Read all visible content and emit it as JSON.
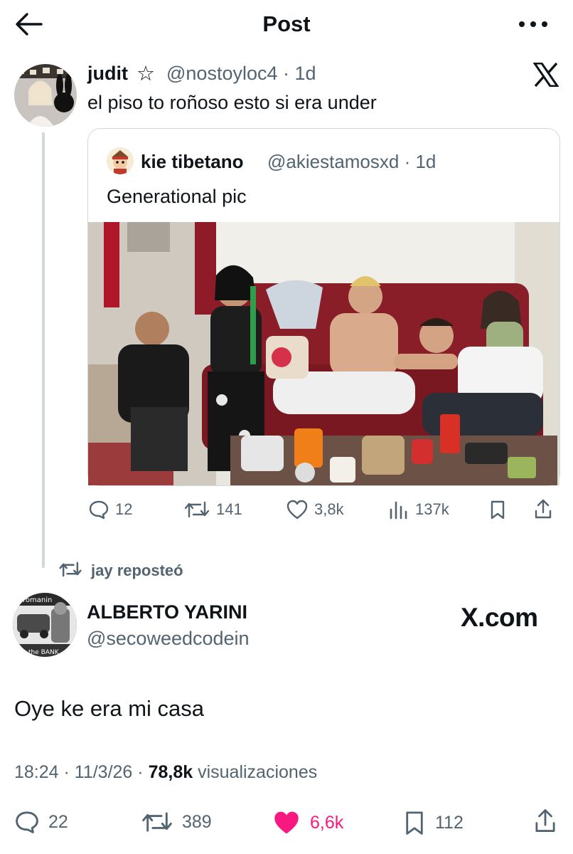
{
  "header": {
    "title": "Post",
    "back_icon": "arrow-left-icon",
    "more_icon": "more-horizontal-icon"
  },
  "reply_tweet": {
    "name": "judit",
    "badge_icon": "star-outline-icon",
    "handle": "@nostoyloc4",
    "time": "· 1d",
    "text": "el piso to roñoso esto si era under",
    "logo_icon": "x-logo-icon"
  },
  "quoted_tweet": {
    "name": "kie tibetano",
    "handle": "@akiestamosxd",
    "time": "· 1d",
    "text": "Generational pic",
    "image": "group-photo-on-red-sofa"
  },
  "quoted_actions": {
    "replies": "12",
    "reposts": "141",
    "likes": "3,8k",
    "views": "137k"
  },
  "repost_line": {
    "text": "jay reposteó",
    "icon": "repost-icon"
  },
  "main_tweet": {
    "name": "ALBERTO YARINI",
    "handle": "@secoweedcodein",
    "brand": "X.com",
    "text": "Oye ke era mi casa",
    "meta_time": "18:24 · 11/3/26 ·",
    "meta_views": "78,8k",
    "meta_views_label": "visualizaciones"
  },
  "main_actions": {
    "replies": "22",
    "reposts": "389",
    "likes": "6,6k",
    "bookmarks": "112",
    "like_color": "#f91880"
  }
}
